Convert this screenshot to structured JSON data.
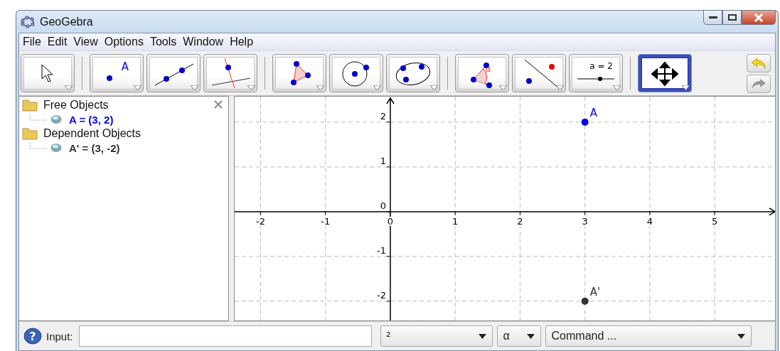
{
  "window": {
    "title": "GeoGebra"
  },
  "menu": [
    "File",
    "Edit",
    "View",
    "Options",
    "Tools",
    "Window",
    "Help"
  ],
  "toolbar": {
    "groups": [
      [
        {
          "kind": "move",
          "selected": false
        }
      ],
      [
        {
          "kind": "point",
          "label": "A",
          "selected": false
        },
        {
          "kind": "line",
          "selected": false
        },
        {
          "kind": "perpendicular",
          "selected": false
        }
      ],
      [
        {
          "kind": "polygon",
          "selected": false
        },
        {
          "kind": "circle",
          "selected": false
        },
        {
          "kind": "conic",
          "selected": false
        }
      ],
      [
        {
          "kind": "angle",
          "label": "α",
          "selected": false
        },
        {
          "kind": "reflect",
          "selected": false
        },
        {
          "kind": "slider",
          "label": "a = 2",
          "selected": false
        }
      ],
      [
        {
          "kind": "move-view",
          "selected": true
        }
      ]
    ],
    "undo": {
      "disabled": false
    },
    "redo": {
      "disabled": true
    }
  },
  "algebra_view": {
    "folders": [
      {
        "label": "Free Objects",
        "children": [
          {
            "label": "A = (3, 2)",
            "color": "#0000ff"
          }
        ]
      },
      {
        "label": "Dependent Objects",
        "children": [
          {
            "label": "A' = (3, -2)",
            "color": "#333333"
          }
        ]
      }
    ]
  },
  "graphics_view": {
    "chart_data": {
      "type": "scatter",
      "grid": true,
      "x": [
        3
      ],
      "series": [
        {
          "name": "A",
          "color": "#0000ff",
          "values": [
            2
          ]
        },
        {
          "name": "A'",
          "color": "#333333",
          "values": [
            -2
          ]
        }
      ],
      "xlim": [
        -2.4,
        5.93
      ],
      "ylim": [
        -2.43,
        2.57
      ],
      "xticks": [
        -2,
        -1,
        0,
        1,
        2,
        3,
        4,
        5
      ],
      "yticks": [
        -2,
        -1,
        0,
        1,
        2
      ]
    }
  },
  "input_bar": {
    "help": "?",
    "label": "Input:",
    "dropdowns": [
      "²",
      "α",
      "Command ..."
    ]
  }
}
